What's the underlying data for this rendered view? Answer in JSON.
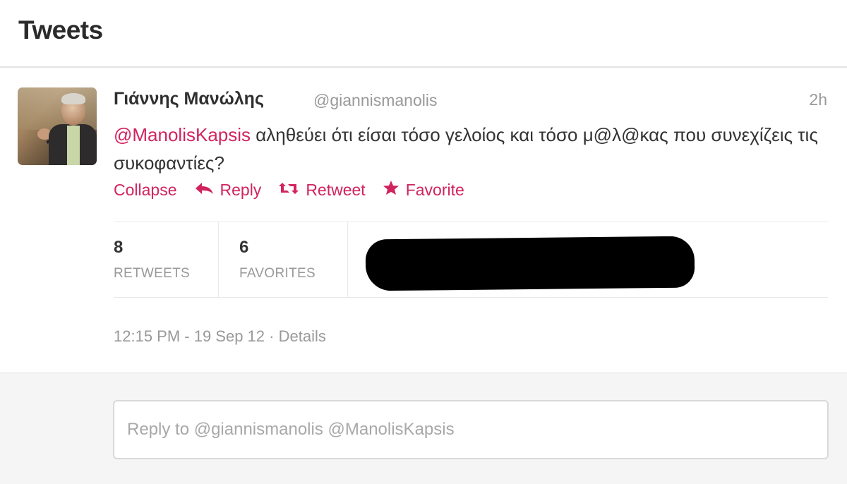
{
  "header": {
    "title": "Tweets"
  },
  "tweet": {
    "author_name": "Γιάννης Μανώλης",
    "author_handle": "@giannismanolis",
    "time_ago": "2h",
    "mention": "@ManolisKapsis",
    "text": " αληθεύει ότι είσαι τόσο γελοίος και τόσο μ@λ@κας που συνεχίζεις τις συκοφαντίες?",
    "actions": {
      "collapse": "Collapse",
      "reply": "Reply",
      "retweet": "Retweet",
      "favorite": "Favorite"
    },
    "stats": {
      "retweets_count": "8",
      "retweets_label": "RETWEETS",
      "favorites_count": "6",
      "favorites_label": "FAVORITES"
    },
    "timestamp": "12:15 PM - 19 Sep 12",
    "separator": " · ",
    "details_label": "Details"
  },
  "reply": {
    "placeholder": "Reply to @giannismanolis @ManolisKapsis"
  },
  "colors": {
    "accent": "#d1245f",
    "muted": "#999999",
    "text": "#333333"
  },
  "icons": {
    "reply": "reply-arrow-icon",
    "retweet": "retweet-icon",
    "favorite": "star-icon"
  }
}
